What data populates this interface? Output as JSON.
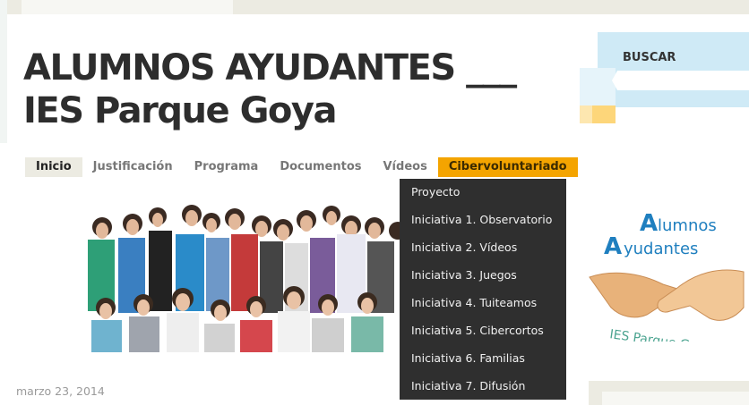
{
  "site": {
    "title_line1": "ALUMNOS AYUDANTES ___",
    "title_line2": "IES Parque Goya"
  },
  "search": {
    "title": "BUSCAR",
    "placeholder": ""
  },
  "nav": {
    "items": [
      {
        "label": "Inicio"
      },
      {
        "label": "Justificación"
      },
      {
        "label": "Programa"
      },
      {
        "label": "Documentos"
      },
      {
        "label": "Vídeos"
      },
      {
        "label": "Cibervoluntariado"
      }
    ]
  },
  "dropdown": {
    "items": [
      {
        "label": "Proyecto"
      },
      {
        "label": "Iniciativa 1. Observatorio"
      },
      {
        "label": "Iniciativa 2. Vídeos"
      },
      {
        "label": "Iniciativa 3. Juegos"
      },
      {
        "label": "Iniciativa 4. Tuiteamos"
      },
      {
        "label": "Iniciativa 5. Cibercortos"
      },
      {
        "label": "Iniciativa 6. Familias"
      },
      {
        "label": "Iniciativa 7. Difusión"
      }
    ]
  },
  "logo": {
    "word1_initial": "A",
    "word1_rest": "lumnos",
    "word2_initial": "A",
    "word2_rest": "yudantes",
    "subtitle": "IES Parque Goya"
  },
  "post": {
    "date": "marzo 23, 2014"
  },
  "colors": {
    "accent": "#f4a400",
    "dropdown_bg": "#2f2f2f",
    "logo_blue": "#2a8fc9"
  }
}
